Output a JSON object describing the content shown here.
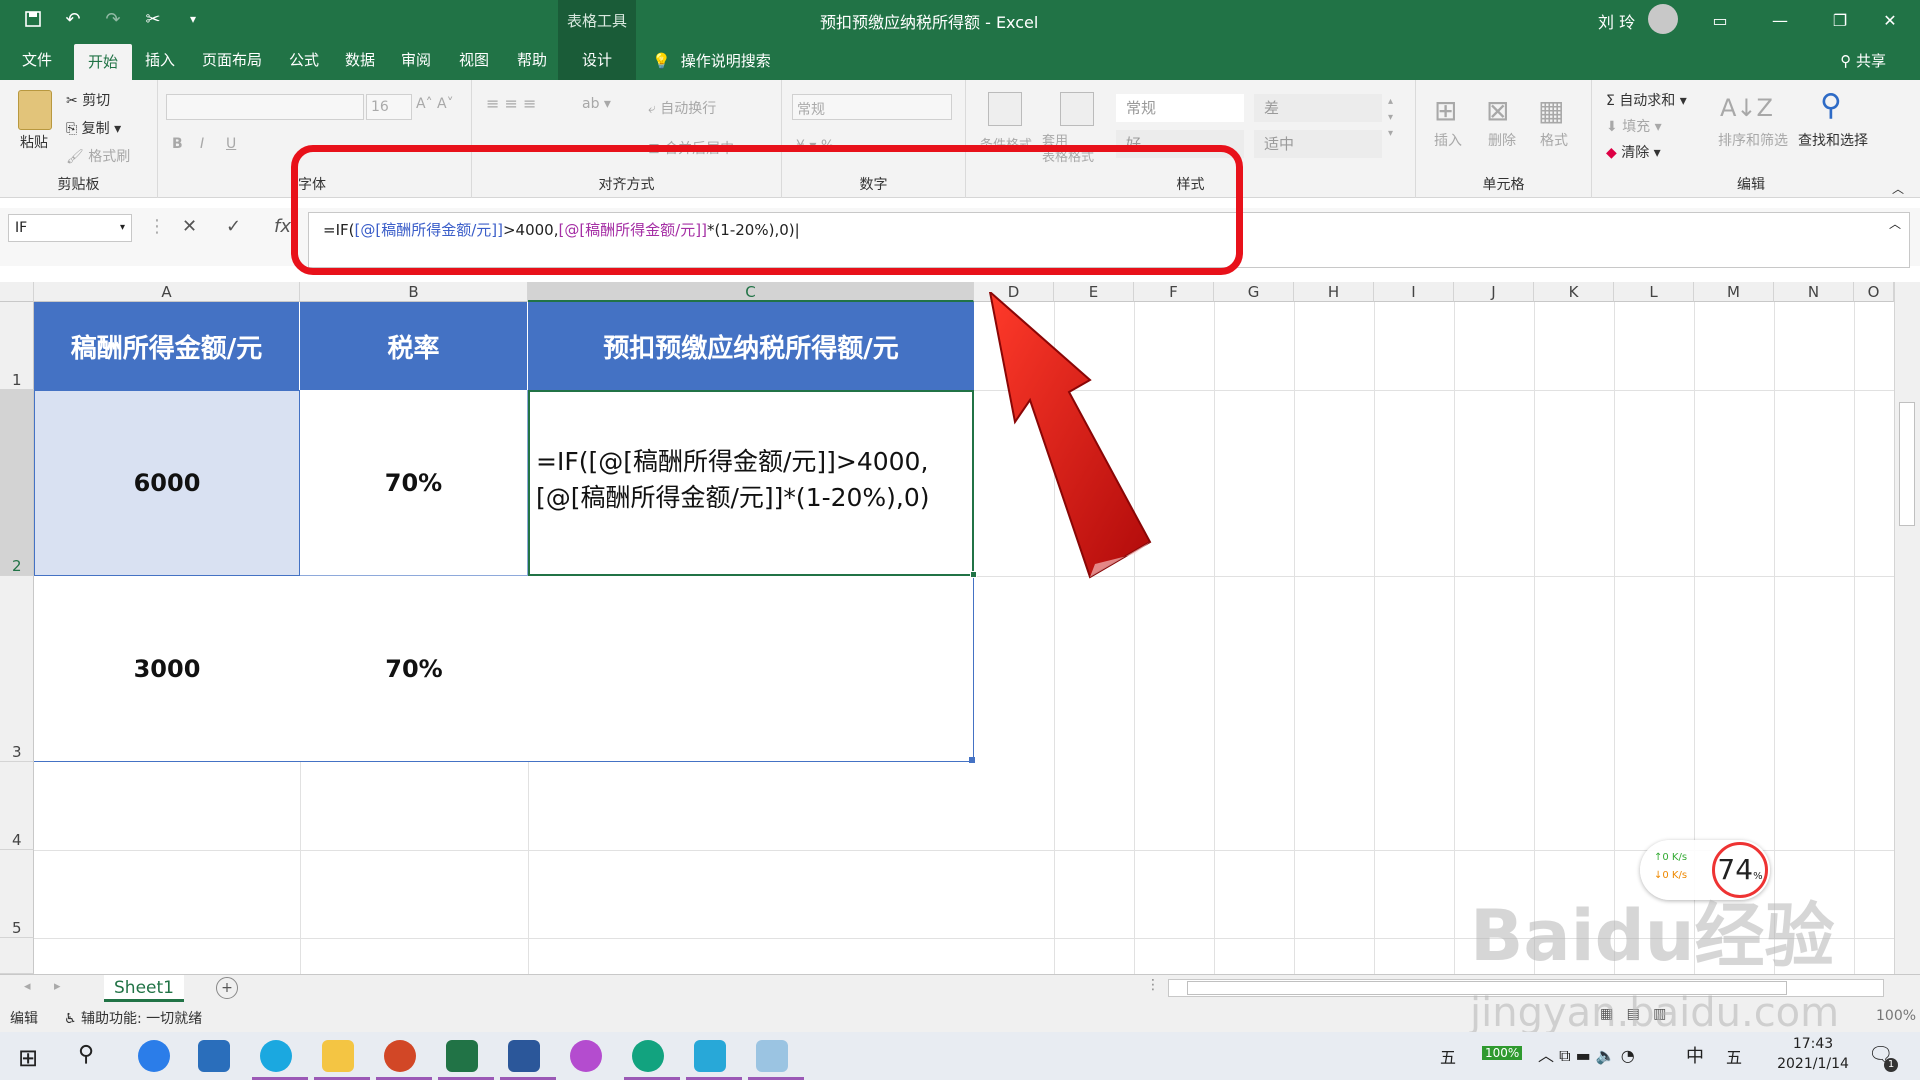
{
  "titlebar": {
    "context_tools": "表格工具",
    "title": "预扣预缴应纳税所得额  -  Excel",
    "user": "刘 玲"
  },
  "tabs": [
    "文件",
    "开始",
    "插入",
    "页面布局",
    "公式",
    "数据",
    "审阅",
    "视图",
    "帮助",
    "设计"
  ],
  "tell_me": "操作说明搜索",
  "share": "共享",
  "ribbon": {
    "clipboard": {
      "paste": "粘贴",
      "cut": "剪切",
      "copy": "复制",
      "painter": "格式刷",
      "label": "剪贴板"
    },
    "font": {
      "size": "16",
      "label": "字体"
    },
    "alignment": {
      "wrap": "自动换行",
      "merge": "合并后居中",
      "label": "对齐方式"
    },
    "number": {
      "format": "常规",
      "label": "数字"
    },
    "styles": {
      "cond": "条件格式",
      "table": "套用\n表格格式",
      "s1": "常规",
      "s2": "差",
      "s3": "好",
      "s4": "适中",
      "label": "样式"
    },
    "cells": {
      "insert": "插入",
      "delete": "删除",
      "format": "格式",
      "label": "单元格"
    },
    "editing": {
      "autosum": "自动求和",
      "fill": "填充",
      "clear": "清除",
      "sort": "排序和筛选",
      "find": "查找和选择",
      "label": "编辑"
    }
  },
  "formula_bar": {
    "name_box": "IF",
    "formula_prefix": "=IF(",
    "ref1": "[@[稿酬所得金额/元]]",
    "mid": ">4000,",
    "ref2": "[@[稿酬所得金额/元]]",
    "suffix": "*(1-20%),0)"
  },
  "columns": [
    "A",
    "B",
    "C",
    "D",
    "E",
    "F",
    "G",
    "H",
    "I",
    "J",
    "K",
    "L",
    "M",
    "N",
    "O"
  ],
  "rows": [
    "1",
    "2",
    "3",
    "4",
    "5"
  ],
  "table": {
    "headers": [
      "稿酬所得金额/元",
      "税率",
      "预扣预缴应纳税所得额/元"
    ],
    "row2": {
      "amount": "6000",
      "rate": "70%",
      "formula": "=IF([@[稿酬所得金额/元]]>4000,\n[@[稿酬所得金额/元]]*(1-20%),0)"
    },
    "row3": {
      "amount": "3000",
      "rate": "70%"
    }
  },
  "sheet": "Sheet1",
  "status": {
    "mode": "编辑",
    "accessibility": "辅助功能: 一切就绪",
    "zoom": "100%"
  },
  "speed": {
    "up": "0  K/s",
    "down": "0  K/s",
    "percent": "74"
  },
  "watermark": "Baidu经验",
  "watermark_url": "jingyan.baidu.com",
  "tray": {
    "ime1": "五",
    "battery": "100%",
    "lang": "中",
    "ime2": "五",
    "time": "17:43",
    "date": "2021/1/14",
    "notif": "1"
  },
  "colors": {
    "excel_green": "#217346",
    "header_blue": "#4472c4",
    "selected_fill": "#d9e1f2",
    "highlight_red": "#e8111a"
  }
}
